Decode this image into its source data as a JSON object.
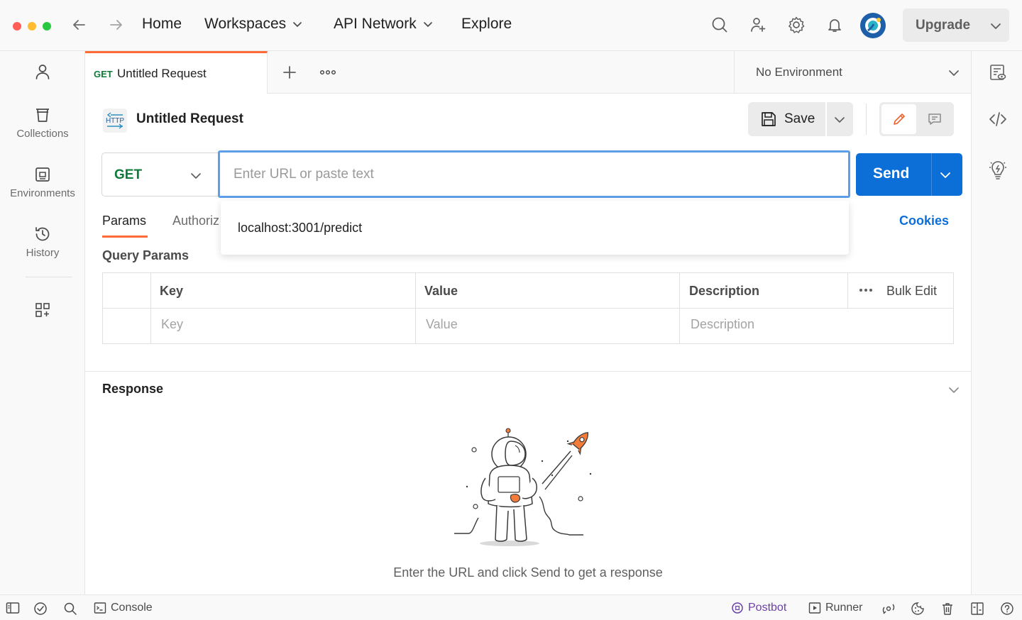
{
  "nav": {
    "home": "Home",
    "workspaces": "Workspaces",
    "api_network": "API Network",
    "explore": "Explore",
    "upgrade": "Upgrade"
  },
  "sidebar": {
    "items": [
      {
        "label": "",
        "icon": "user-icon"
      },
      {
        "label": "Collections",
        "icon": "trash-collections-icon"
      },
      {
        "label": "Environments",
        "icon": "environment-icon"
      },
      {
        "label": "History",
        "icon": "history-icon"
      },
      {
        "label": "",
        "icon": "apps-grid-icon"
      }
    ]
  },
  "tabs": {
    "active": {
      "method": "GET",
      "name": "Untitled Request"
    }
  },
  "environment": {
    "selected": "No Environment"
  },
  "request": {
    "title": "Untitled Request",
    "save_label": "Save",
    "method": "GET",
    "url_placeholder": "Enter URL or paste text",
    "send_label": "Send",
    "suggestion": "localhost:3001/predict"
  },
  "request_tabs": {
    "params": "Params",
    "authorization": "Authoriz",
    "cookies": "Cookies"
  },
  "query_params": {
    "title": "Query Params",
    "headers": [
      "Key",
      "Value",
      "Description"
    ],
    "placeholders": [
      "Key",
      "Value",
      "Description"
    ],
    "bulk_edit": "Bulk Edit"
  },
  "response": {
    "title": "Response",
    "hint": "Enter the URL and click Send to get a response"
  },
  "statusbar": {
    "console": "Console",
    "postbot": "Postbot",
    "runner": "Runner"
  },
  "colors": {
    "accent_orange": "#ff6c37",
    "send_blue": "#0c6fd8",
    "get_green": "#0f7a3a",
    "postbot_purple": "#6b3fa8"
  }
}
